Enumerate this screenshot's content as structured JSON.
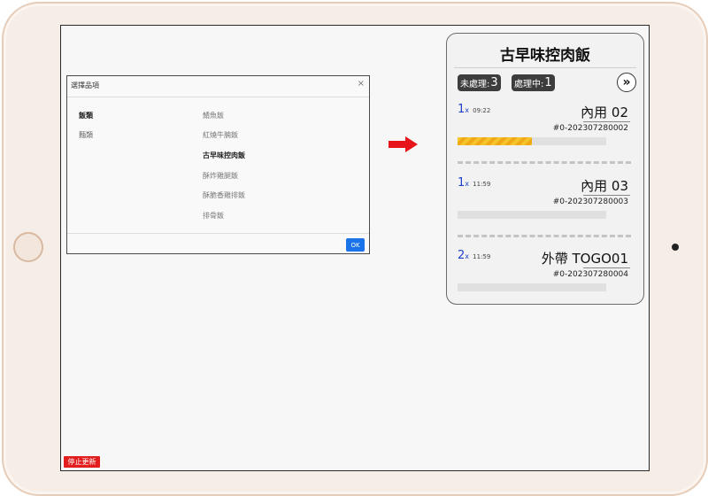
{
  "modal": {
    "title": "選擇品項",
    "close": "×",
    "categories": [
      "飯類",
      "麵類"
    ],
    "items": [
      "鯖魚飯",
      "紅燒牛腩飯",
      "古早味控肉飯",
      "酥炸雞腿飯",
      "酥脆香雞排飯",
      "排骨飯"
    ],
    "ok_label": "OK"
  },
  "panel": {
    "title": "古早味控肉飯",
    "pending_label": "未處理:",
    "pending_count": "3",
    "processing_label": "處理中:",
    "processing_count": "1",
    "orders": [
      {
        "qty": "1",
        "x": "x",
        "time": "09:22",
        "table": "內用 02",
        "order_no": "#0-202307280002",
        "progress": 0.5
      },
      {
        "qty": "1",
        "x": "x",
        "time": "11:59",
        "table": "內用 03",
        "order_no": "#0-202307280003",
        "progress": 0
      },
      {
        "qty": "2",
        "x": "x",
        "time": "11:59",
        "table": "外帶 TOGO01",
        "order_no": "#0-202307280004",
        "progress": 0
      }
    ]
  },
  "stop_button": "停止更新",
  "colors": {
    "accent_blue": "#1a73e8",
    "qty_blue": "#1d3fc9",
    "stop_red": "#e31e1e",
    "progress_yellow": "#f5c32c",
    "arrow_red": "#e8141b"
  },
  "icons": {
    "next": "double-chevron-right-icon",
    "arrow": "arrow-right-icon"
  }
}
